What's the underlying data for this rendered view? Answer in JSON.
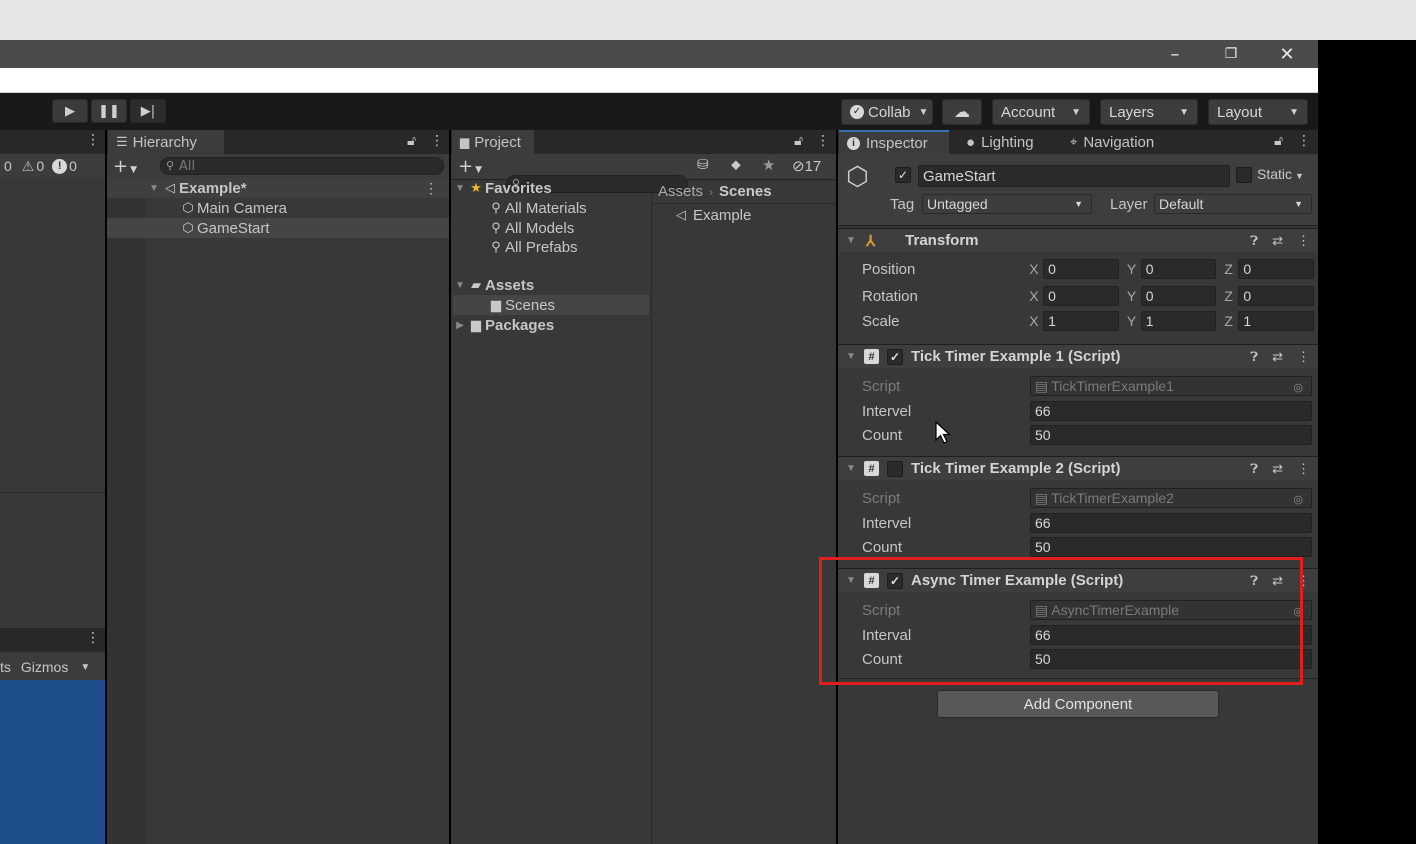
{
  "window": {
    "minimize_glyph": "–",
    "restore_glyph": "❐",
    "close_glyph": "✕"
  },
  "toolbar": {
    "collab": "Collab",
    "account": "Account",
    "layers": "Layers",
    "layout": "Layout"
  },
  "console": {
    "log_count": "0",
    "warn_count": "0",
    "error_count": "0"
  },
  "scene_view": {
    "gizmos_label": "Gizmos",
    "partial_label": "ts"
  },
  "hierarchy": {
    "tab_label": "Hierarchy",
    "search_placeholder": "All",
    "scene_name": "Example*",
    "items": [
      "Main Camera",
      "GameStart"
    ]
  },
  "project": {
    "tab_label": "Project",
    "hidden_count": "17",
    "favorites_label": "Favorites",
    "favorites": [
      "All Materials",
      "All Models",
      "All Prefabs"
    ],
    "assets_label": "Assets",
    "assets_children": [
      "Scenes"
    ],
    "packages_label": "Packages",
    "breadcrumb": [
      "Assets",
      "Scenes"
    ],
    "files": [
      "Example"
    ]
  },
  "inspector": {
    "tabs": [
      "Inspector",
      "Lighting",
      "Navigation"
    ],
    "object_name": "GameStart",
    "static_label": "Static",
    "tag_label": "Tag",
    "tag_value": "Untagged",
    "layer_label": "Layer",
    "layer_value": "Default",
    "transform": {
      "title": "Transform",
      "rows": [
        {
          "label": "Position",
          "x": "0",
          "y": "0",
          "z": "0"
        },
        {
          "label": "Rotation",
          "x": "0",
          "y": "0",
          "z": "0"
        },
        {
          "label": "Scale",
          "x": "1",
          "y": "1",
          "z": "1"
        }
      ]
    },
    "components": [
      {
        "title": "Tick Timer Example 1 (Script)",
        "enabled": true,
        "script": "TickTimerExample1",
        "field1_label": "Intervel",
        "field1": "66",
        "field2_label": "Count",
        "field2": "50"
      },
      {
        "title": "Tick Timer Example 2 (Script)",
        "enabled": false,
        "script": "TickTimerExample2",
        "field1_label": "Intervel",
        "field1": "66",
        "field2_label": "Count",
        "field2": "50"
      },
      {
        "title": "Async Timer Example (Script)",
        "enabled": true,
        "script": "AsyncTimerExample",
        "field1_label": "Interval",
        "field1": "66",
        "field2_label": "Count",
        "field2": "50"
      }
    ],
    "script_label": "Script",
    "add_component": "Add Component"
  },
  "colors": {
    "highlight_box": "#e01e1e",
    "scene_blue": "#1f4e8c",
    "accent_tab": "#3a72b0"
  }
}
